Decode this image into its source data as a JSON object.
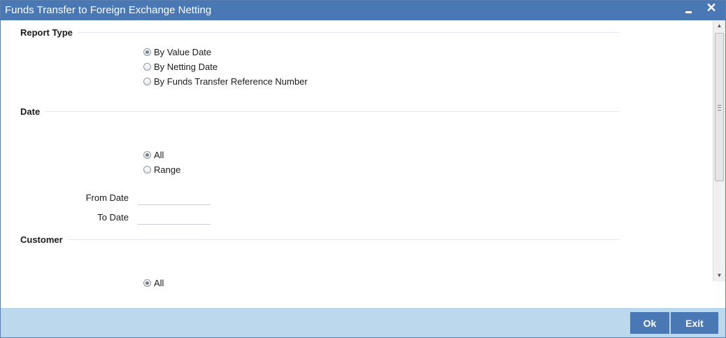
{
  "window": {
    "title": "Funds Transfer to Foreign Exchange Netting",
    "minimize_icon": "minimize-icon",
    "close_icon": "close-icon",
    "close_glyph": "✕"
  },
  "report_type": {
    "heading": "Report Type",
    "options": [
      {
        "label": "By Value Date",
        "checked": true
      },
      {
        "label": "By Netting Date",
        "checked": false
      },
      {
        "label": "By Funds Transfer Reference Number",
        "checked": false
      }
    ]
  },
  "date": {
    "heading": "Date",
    "options": [
      {
        "label": "All",
        "checked": true
      },
      {
        "label": "Range",
        "checked": false
      }
    ],
    "from_label": "From Date",
    "from_value": "",
    "to_label": "To Date",
    "to_value": ""
  },
  "customer": {
    "heading": "Customer",
    "options": [
      {
        "label": "All",
        "checked": true
      }
    ]
  },
  "footer": {
    "ok_label": "Ok",
    "exit_label": "Exit"
  },
  "colors": {
    "titlebar": "#4a78b5",
    "footer": "#bcd8ec",
    "button": "#4a78b5"
  }
}
